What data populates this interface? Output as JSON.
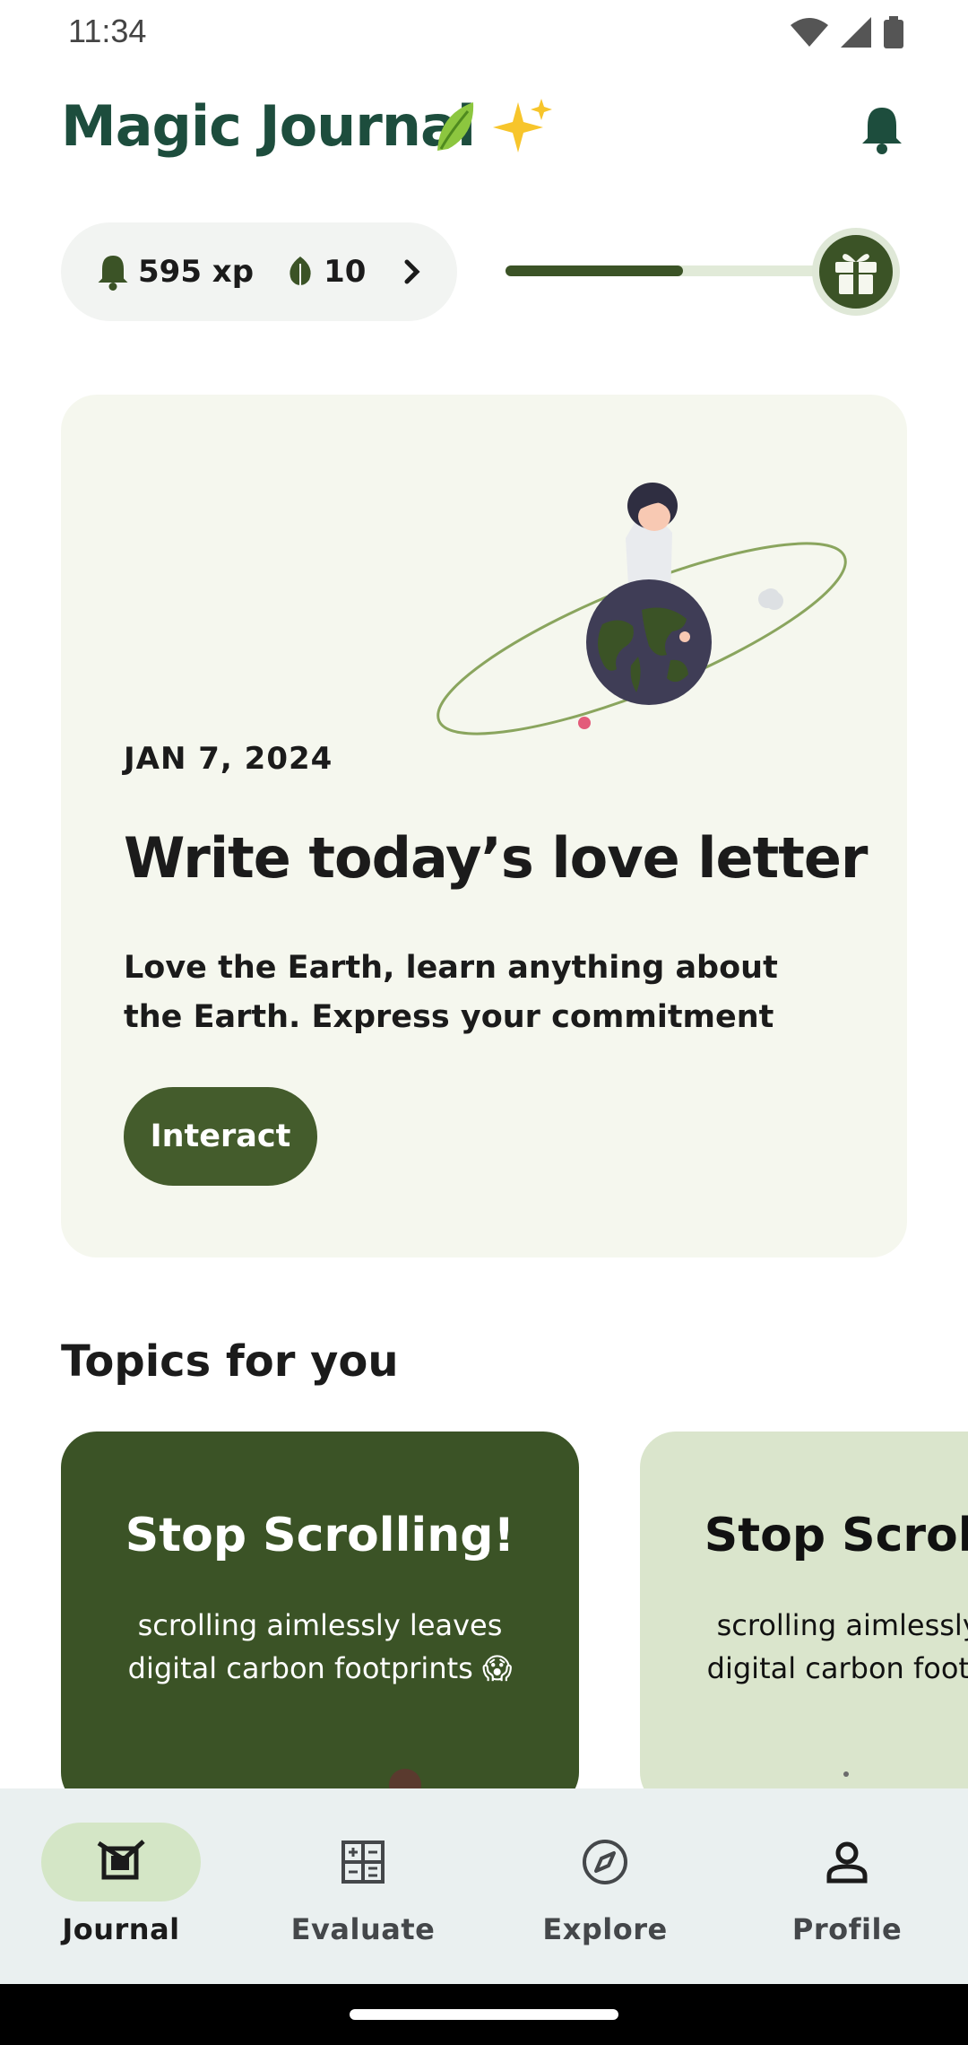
{
  "status_bar": {
    "time": "11:34",
    "icons": [
      "wifi-icon",
      "signal-icon",
      "battery-icon"
    ]
  },
  "header": {
    "title": "Magic Journal",
    "emoji": "🍃✨",
    "bell_icon": "bell-icon"
  },
  "stats": {
    "xp": "595 xp",
    "leaves": "10",
    "progress": 0.55
  },
  "daily_card": {
    "date": "JAN 7, 2024",
    "title": "Write today’s love letter",
    "description": "Love the Earth, learn anything about the Earth. Express your commitment",
    "button_label": "Interact"
  },
  "topics": {
    "section_title": "Topics for you",
    "cards": [
      {
        "title": "Stop Scrolling!",
        "description": "scrolling aimlessly leaves digital carbon footprints 😱"
      },
      {
        "title": "Stop Scrolling!",
        "description": "scrolling aimlessly leaves digital carbon footprints 😱"
      }
    ]
  },
  "bottom_nav": {
    "items": [
      {
        "label": "Journal",
        "icon": "journal-icon",
        "active": true
      },
      {
        "label": "Evaluate",
        "icon": "calculator-icon",
        "active": false
      },
      {
        "label": "Explore",
        "icon": "compass-icon",
        "active": false
      },
      {
        "label": "Profile",
        "icon": "person-icon",
        "active": false
      }
    ]
  },
  "colors": {
    "brand_green": "#1d4d3d",
    "dark_green": "#3b5326",
    "card_bg": "#f5f7ee",
    "nav_bg": "#eaf0f0"
  }
}
